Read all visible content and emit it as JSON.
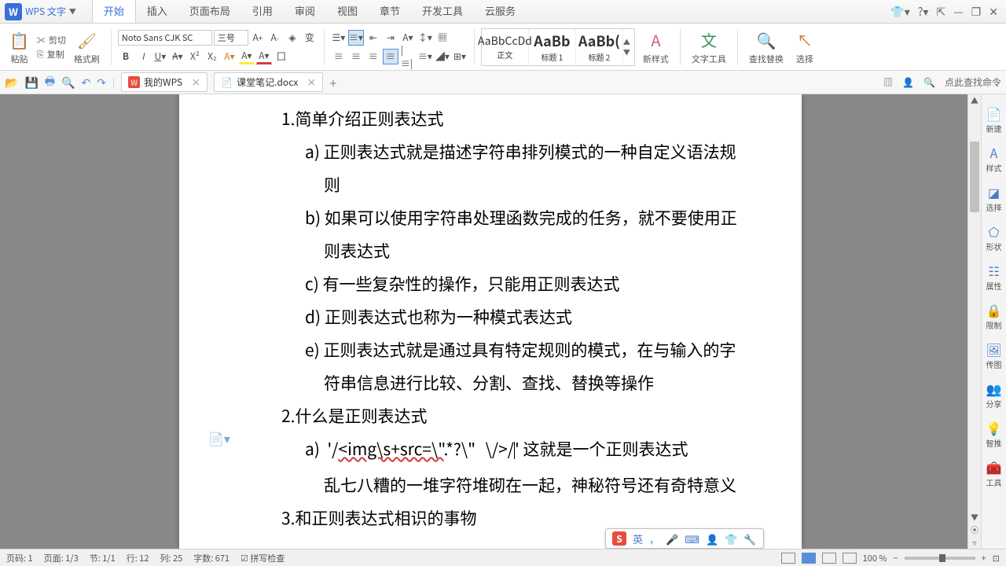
{
  "app": {
    "name": "WPS 文字"
  },
  "menu": {
    "tabs": [
      "开始",
      "插入",
      "页面布局",
      "引用",
      "审阅",
      "视图",
      "章节",
      "开发工具",
      "云服务"
    ],
    "active": 0
  },
  "title_controls": {
    "skin": "▾",
    "help": "?▾",
    "share": "⇱",
    "min": "—",
    "max": "❐",
    "close": "✕"
  },
  "ribbon": {
    "paste": "粘贴",
    "cut": "剪切",
    "copy": "复制",
    "format_painter": "格式刷",
    "font_name": "Noto Sans CJK SC",
    "font_size": "三号",
    "new_style": "新样式",
    "text_tool": "文字工具",
    "find_replace": "查找替换",
    "select": "选择"
  },
  "styles": [
    {
      "preview": "AaBbCcDd",
      "name": "正文"
    },
    {
      "preview": "AaBb",
      "name": "标题 1"
    },
    {
      "preview": "AaBb(",
      "name": "标题 2"
    }
  ],
  "docbar": {
    "tabs": [
      {
        "icon": "W",
        "label": "我的WPS"
      },
      {
        "icon": "📄",
        "label": "课堂笔记.docx"
      }
    ],
    "add": "+",
    "right": {
      "assist": "⊞",
      "user": "👤",
      "search_prompt": "点此查找命令"
    }
  },
  "document": {
    "h1": "1.简单介绍正则表达式",
    "a": "正则表达式就是描述字符串排列模式的一种自定义语法规则",
    "b": "如果可以使用字符串处理函数完成的任务，就不要使用正则表达式",
    "c": "有一些复杂性的操作，只能用正则表达式",
    "d": "正则表达式也称为一种模式表达式",
    "e": "正则表达式就是通过具有特定规则的模式，在与输入的字符串信息进行比较、分割、查找、替换等操作",
    "h2": "2.什么是正则表达式",
    "regex_prefix": "'/",
    "regex_body": "<img\\s+src=\\\"",
    "regex_mid": ".*?\\\"",
    "regex_tail": "\\/>/",
    "regex_after": "'   这就是一个正则表达式",
    "note": "乱七八糟的一堆字符堆砌在一起，神秘符号还有奇特意义",
    "h3": "3.和正则表达式相识的事物"
  },
  "sidepanel": [
    "新建",
    "样式",
    "选择",
    "形状",
    "属性",
    "限制",
    "传图",
    "分享",
    "智推",
    "工具"
  ],
  "status": {
    "page": "页码: 1",
    "pages": "页面: 1/3",
    "sec": "节: 1/1",
    "line": "行: 12",
    "col": "列: 25",
    "words": "字数: 671",
    "spell": "拼写检查",
    "zoom": "100 %"
  },
  "ime": {
    "lang": "英",
    "punct": "，"
  }
}
